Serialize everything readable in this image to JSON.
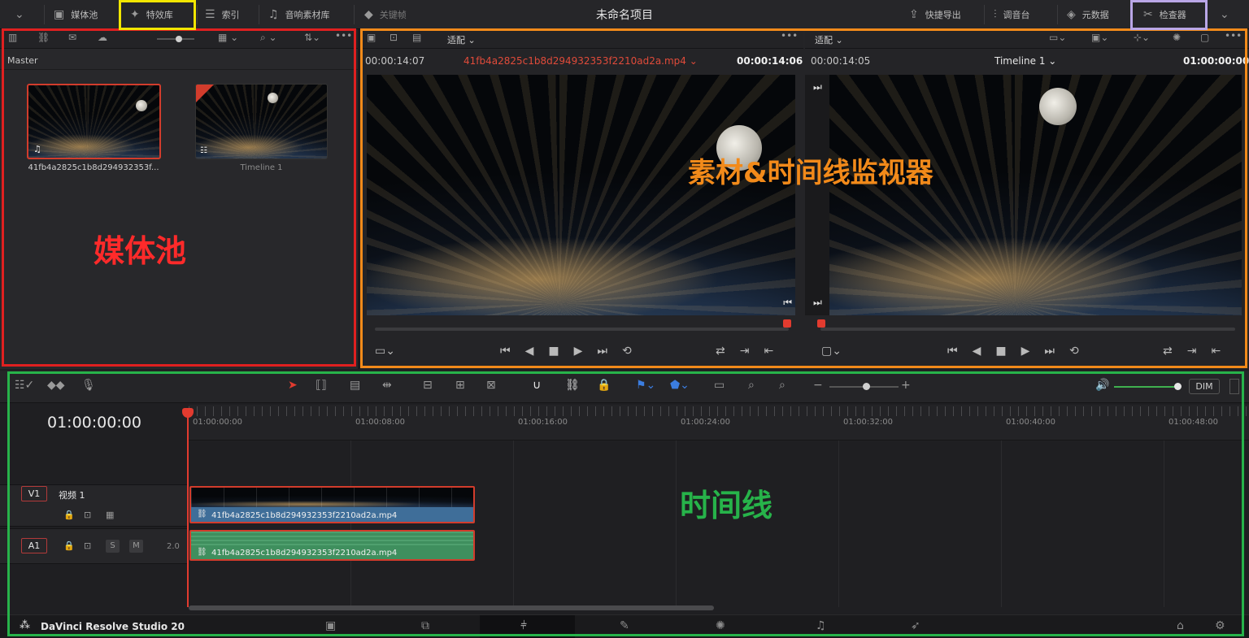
{
  "topbar": {
    "media_pool": "媒体池",
    "effects": "特效库",
    "index": "索引",
    "sound_library": "音响素材库",
    "keyframes": "关键帧",
    "project_title": "未命名项目",
    "quick_export": "快捷导出",
    "mixer": "调音台",
    "metadata": "元数据",
    "inspector": "检查器"
  },
  "media_pool": {
    "bin": "Master",
    "clips": [
      {
        "name": "41fb4a2825c1b8d294932353f..."
      },
      {
        "name": "Timeline 1"
      }
    ]
  },
  "source_viewer": {
    "zoom": "适配",
    "timecode_left": "00:00:14:07",
    "clip_name": "41fb4a2825c1b8d294932353f2210ad2a.mp4",
    "timecode_right": "00:00:14:06"
  },
  "timeline_viewer": {
    "zoom": "适配",
    "timecode_left": "00:00:14:05",
    "timeline_name": "Timeline 1",
    "timecode_right": "01:00:00:00"
  },
  "timeline": {
    "current_tc": "01:00:00:00",
    "dim": "DIM",
    "ruler": [
      "01:00:00:00",
      "01:00:08:00",
      "01:00:16:00",
      "01:00:24:00",
      "01:00:32:00",
      "01:00:40:00",
      "01:00:48:00"
    ],
    "v1": {
      "id": "V1",
      "name": "视频 1",
      "clip": "41fb4a2825c1b8d294932353f2210ad2a.mp4"
    },
    "a1": {
      "id": "A1",
      "solo": "S",
      "mute": "M",
      "level": "2.0",
      "clip": "41fb4a2825c1b8d294932353f2210ad2a.mp4"
    }
  },
  "footer": {
    "app_name": "DaVinci Resolve Studio 20"
  },
  "annotations": {
    "media_pool": "媒体池",
    "viewers": "素材&时间线监视器",
    "timeline": "时间线"
  },
  "colors": {
    "media_pool_box": "#e02020",
    "effects_box": "#f2e600",
    "viewers_box": "#f28a1a",
    "inspector_box": "#b9a6e6",
    "timeline_box": "#27b34a",
    "video_clip": "#3f6e99",
    "audio_clip": "#3f8f5e"
  }
}
